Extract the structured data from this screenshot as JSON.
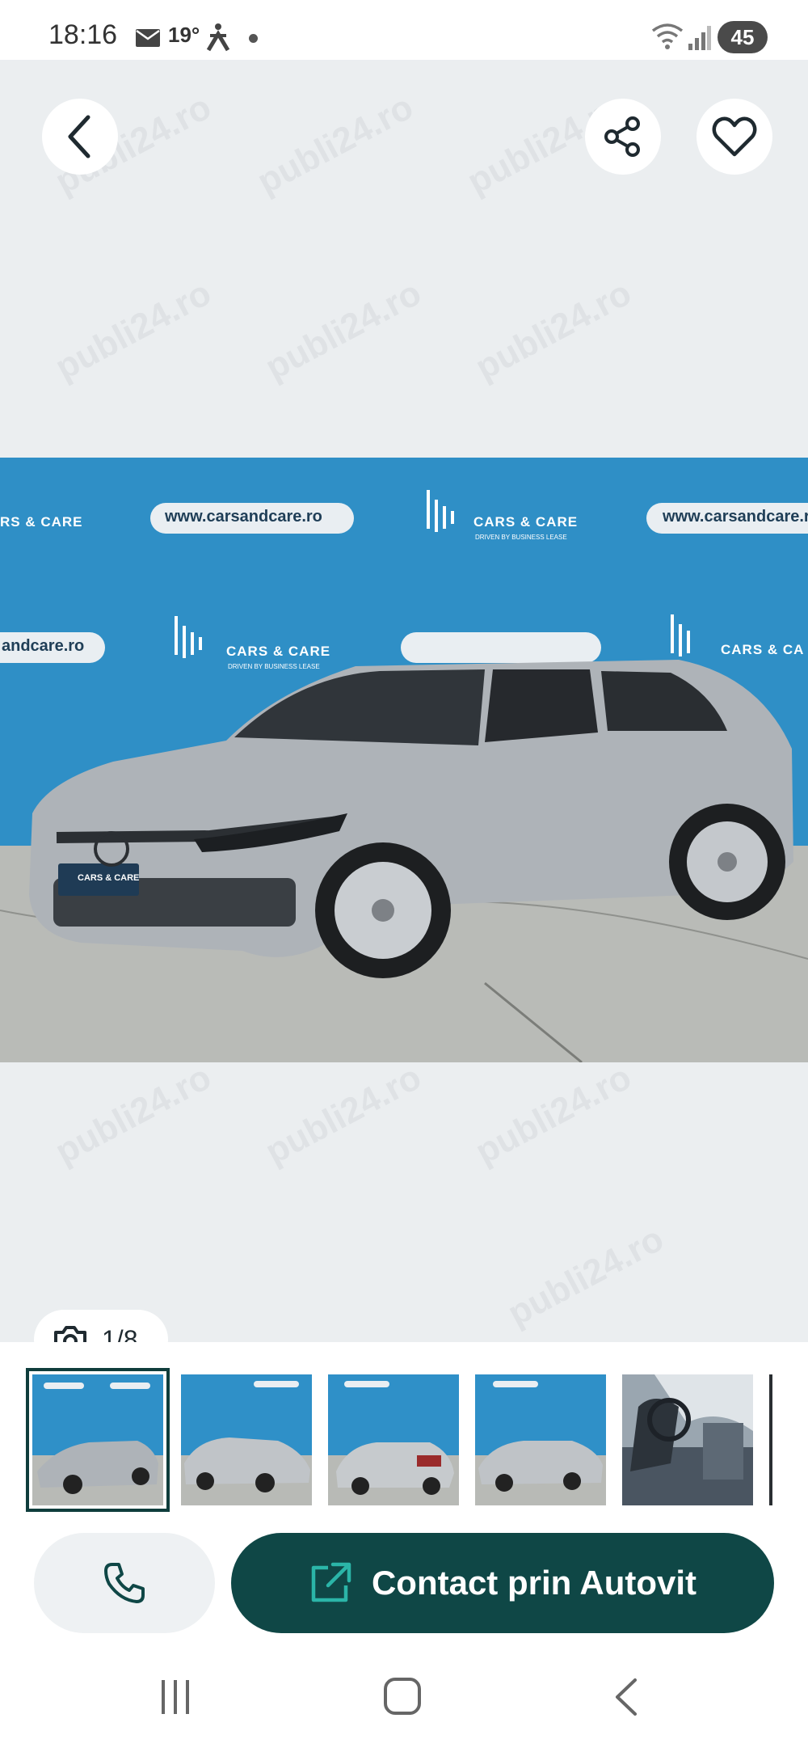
{
  "status_bar": {
    "time": "18:16",
    "temperature": "19°",
    "battery": "45",
    "icons": [
      "mail-icon",
      "person-icon",
      "dot-icon",
      "wifi-icon",
      "signal-icon",
      "battery-icon"
    ]
  },
  "watermark": "publi24.ro",
  "gallery": {
    "back_icon": "chevron-left-icon",
    "share_icon": "share-icon",
    "favorite_icon": "heart-icon",
    "counter_icon": "camera-icon",
    "counter_text": "1/8",
    "photo_texts": {
      "banner_url": "www.carsandcare.ro",
      "banner_url_cut": "andcare.ro",
      "brand": "CARS & CARE",
      "brand_cut": "RS & CARE",
      "brand_cut_right": "CARS & CA",
      "brand_tagline": "DRIVEN BY BUSINESS LEASE",
      "plate": "CARS & CARE",
      "plate_sub": "DRIVEN BY BUSINESS LEASE"
    }
  },
  "thumbnails": [
    {
      "selected": true
    },
    {
      "selected": false
    },
    {
      "selected": false
    },
    {
      "selected": false
    },
    {
      "selected": false
    }
  ],
  "actions": {
    "call_icon": "phone-icon",
    "contact_icon": "external-link-icon",
    "contact_label": "Contact prin Autovit"
  },
  "colors": {
    "primary": "#0f4746",
    "background": "#ebeef0",
    "banner_blue": "#2e8fc7"
  },
  "navbar": {
    "icons": [
      "recent-apps-icon",
      "home-icon",
      "back-icon"
    ]
  }
}
